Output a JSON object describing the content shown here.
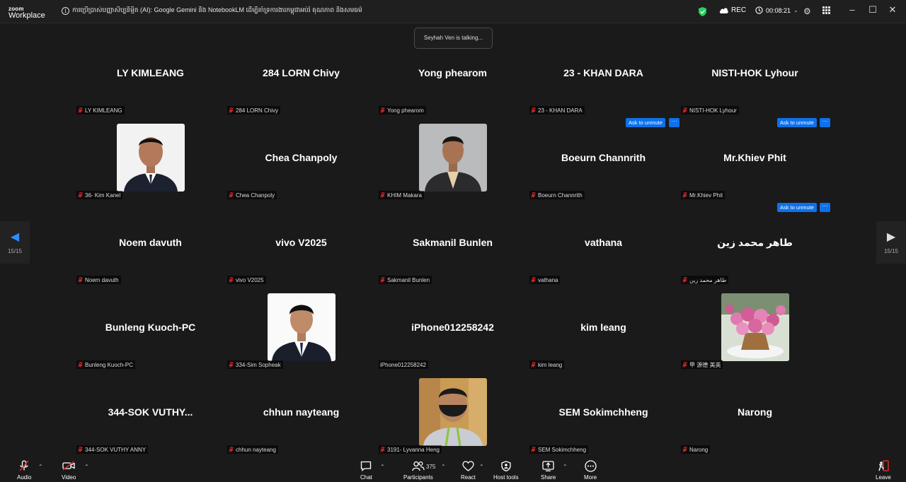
{
  "app": {
    "logo_line1": "zoom",
    "logo_line2": "Workplace",
    "meeting_title": "ការប្រើប្រាស់បញ្ញាសិប្បនិម្មិត (AI): Google Gemini និង NotebookLM ដើម្បីគាំទ្រការងារកម្ពុជាអប់រំ គុណភាព និងសមធម៌",
    "rec_label": "REC",
    "timer": "00:08:21"
  },
  "banner": {
    "talking": "Seyhah Ven is talking..."
  },
  "nav": {
    "left_page": "15/15",
    "right_page": "15/15"
  },
  "participants": [
    {
      "display": "LY KIMLEANG",
      "label": "LY KIMLEANG",
      "photo": null
    },
    {
      "display": "284 LORN Chivy",
      "label": "284 LORN Chivy",
      "photo": null
    },
    {
      "display": "Yong phearom",
      "label": "Yong phearom",
      "photo": null
    },
    {
      "display": "23 - KHAN DARA",
      "label": "23 - KHAN DARA",
      "photo": null
    },
    {
      "display": "NISTI-HOK Lyhour",
      "label": "NISTI-HOK Lyhour",
      "photo": null
    },
    {
      "display": "",
      "label": "36- Kim Kanel",
      "photo": "man-suit-1"
    },
    {
      "display": "Chea Chanpoly",
      "label": "Chea Chanpoly",
      "photo": null
    },
    {
      "display": "",
      "label": "KHIM Makara",
      "photo": "man-suit-2"
    },
    {
      "display": "Boeurn Channrith",
      "label": "Boeurn Channrith",
      "photo": null
    },
    {
      "display": "Mr.Khiev Phit",
      "label": "Mr.Khiev Phit",
      "photo": null
    },
    {
      "display": "Noem davuth",
      "label": "Noem davuth",
      "photo": null
    },
    {
      "display": "vivo V2025",
      "label": "vivo V2025",
      "photo": null
    },
    {
      "display": "Sakmanil Bunlen",
      "label": "Sakmanil Bunlen",
      "photo": null
    },
    {
      "display": "vathana",
      "label": "vathana",
      "photo": null
    },
    {
      "display": "طاهر محمد زين",
      "label": "طاهر محمد زين",
      "photo": null
    },
    {
      "display": "Bunleng Kuoch-PC",
      "label": "Bunleng Kuoch-PC",
      "photo": null
    },
    {
      "display": "",
      "label": "334-Sim Sopheak",
      "photo": "man-suit-3"
    },
    {
      "display": "iPhone012258242",
      "label": "iPhone012258242",
      "photo": null,
      "label_no_mic": true
    },
    {
      "display": "kim leang",
      "label": "kim leang",
      "photo": null
    },
    {
      "display": "",
      "label": "甲 源德 美英",
      "photo": "flowers"
    },
    {
      "display": "344-SOK  VUTHY...",
      "label": "344-SOK VUTHY ANNY",
      "photo": null
    },
    {
      "display": "chhun nayteang",
      "label": "chhun nayteang",
      "photo": null
    },
    {
      "display": "",
      "label": "3191- Lyvanna Heng",
      "photo": "man-mask"
    },
    {
      "display": "SEM Sokimchheng",
      "label": "SEM Sokimchheng",
      "photo": null
    },
    {
      "display": "Narong",
      "label": "Narong",
      "photo": null
    }
  ],
  "ask_unmute": {
    "label": "Ask to unmute",
    "more": "···"
  },
  "toolbar": {
    "audio": "Audio",
    "video": "Video",
    "chat": "Chat",
    "participants": "Participants",
    "participants_count": "375",
    "react": "React",
    "host_tools": "Host tools",
    "share": "Share",
    "more": "More",
    "leave": "Leave"
  },
  "colors": {
    "accent": "#0e71eb",
    "mute_red": "#e02828",
    "shield_green": "#23d160"
  }
}
